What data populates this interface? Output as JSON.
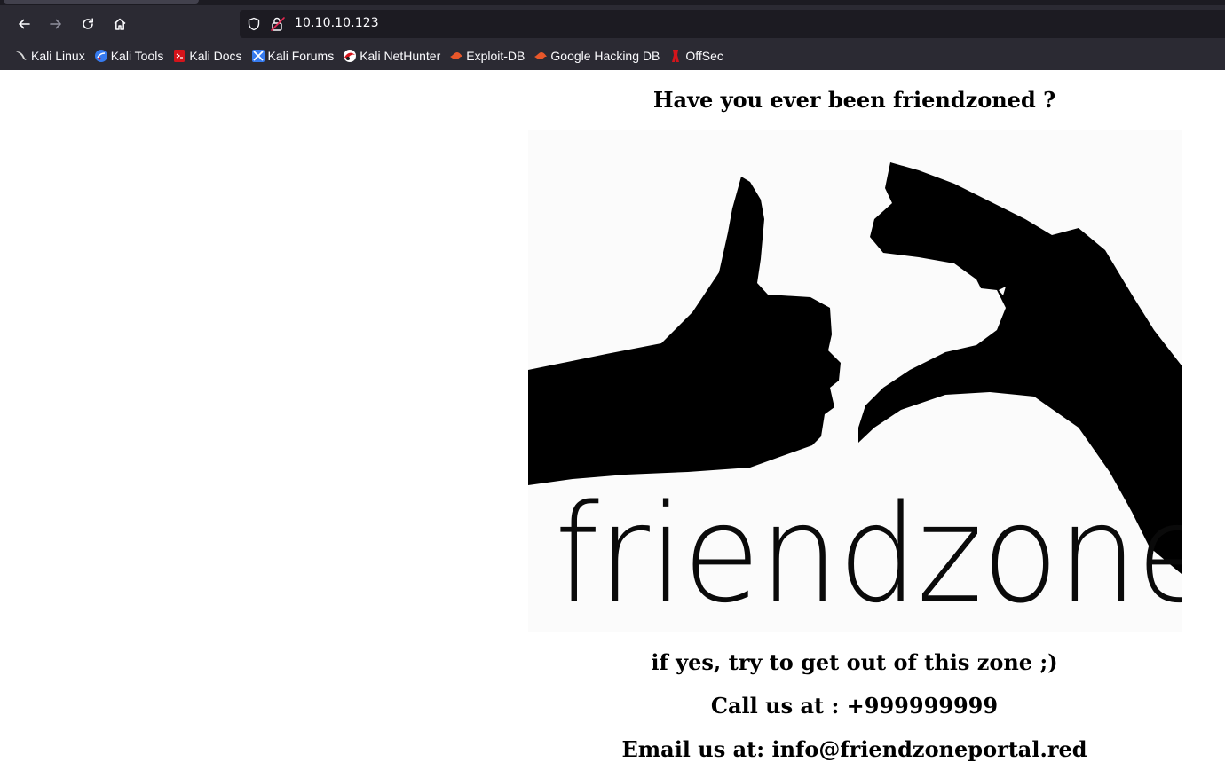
{
  "browser": {
    "url": "10.10.10.123",
    "bookmarks": [
      {
        "label": "Kali Linux",
        "icon": "kali-dragon-icon",
        "color": "#1a1a1a"
      },
      {
        "label": "Kali Tools",
        "icon": "kali-tools-icon",
        "color": "#367bf0"
      },
      {
        "label": "Kali Docs",
        "icon": "kali-docs-icon",
        "color": "#d4141b"
      },
      {
        "label": "Kali Forums",
        "icon": "kali-forums-icon",
        "color": "#367bf0"
      },
      {
        "label": "Kali NetHunter",
        "icon": "kali-nethunter-icon",
        "color": "#d4141b"
      },
      {
        "label": "Exploit-DB",
        "icon": "exploit-db-icon",
        "color": "#e8572a"
      },
      {
        "label": "Google Hacking DB",
        "icon": "google-hacking-db-icon",
        "color": "#e8572a"
      },
      {
        "label": "OffSec",
        "icon": "offsec-icon",
        "color": "#d4141b"
      }
    ]
  },
  "page": {
    "title": "Have you ever been friendzoned ?",
    "image_word": "friendzone",
    "line_yes": "if yes, try to get out of this zone ;)",
    "line_call": "Call us at : +999999999",
    "line_email": "Email us at: info@friendzoneportal.red"
  },
  "colors": {
    "chrome_bg": "#2b2a33",
    "urlbar_bg": "#1c1b22",
    "chrome_text": "#fbfbfe",
    "page_bg": "#ffffff",
    "page_text": "#000000"
  }
}
